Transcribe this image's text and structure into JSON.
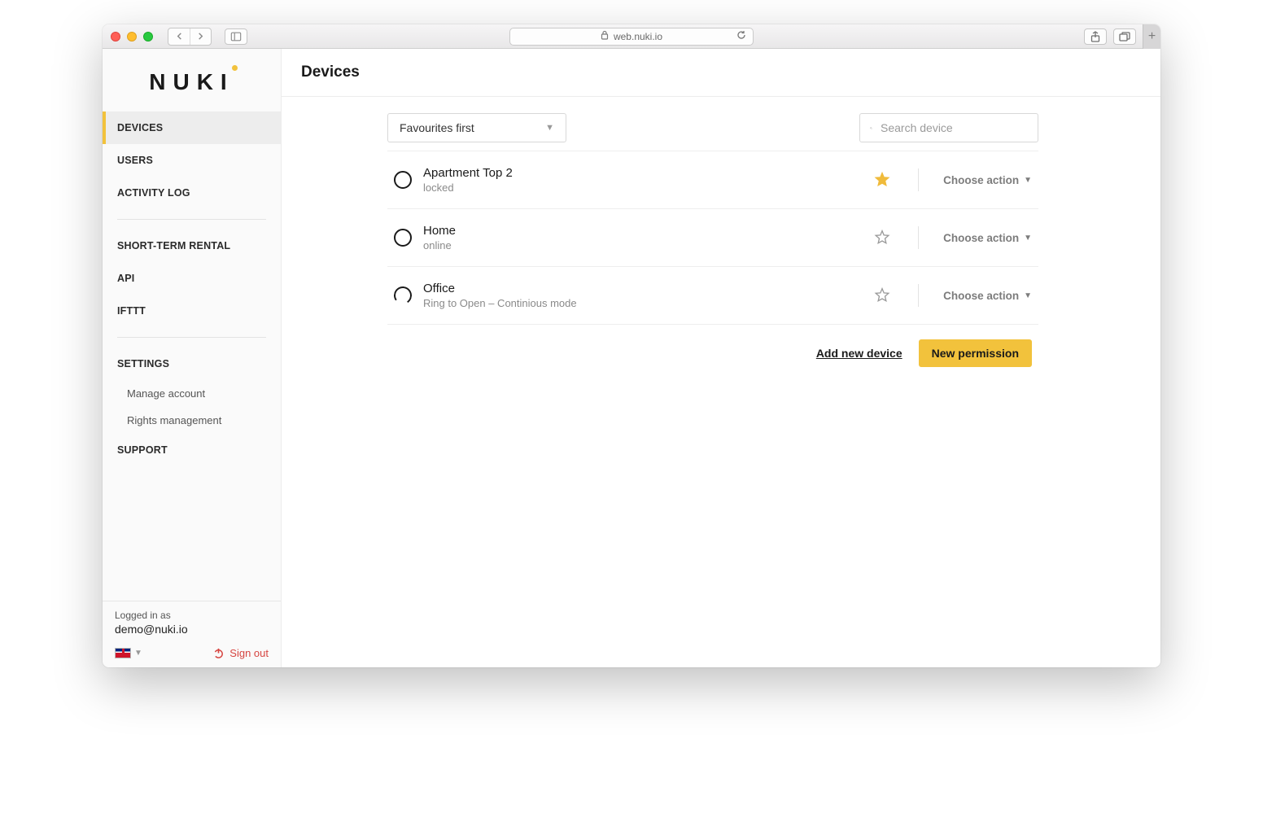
{
  "browser": {
    "url": "web.nuki.io"
  },
  "brand": {
    "logo_text": "NUKI"
  },
  "sidebar": {
    "items": [
      {
        "label": "DEVICES"
      },
      {
        "label": "USERS"
      },
      {
        "label": "ACTIVITY LOG"
      },
      {
        "label": "SHORT-TERM RENTAL"
      },
      {
        "label": "API"
      },
      {
        "label": "IFTTT"
      },
      {
        "label": "SETTINGS"
      },
      {
        "label": "SUPPORT"
      }
    ],
    "settings_sub": [
      {
        "label": "Manage account"
      },
      {
        "label": "Rights management"
      }
    ],
    "footer": {
      "logged_in_as": "Logged in as",
      "email": "demo@nuki.io",
      "signout": "Sign out"
    }
  },
  "page": {
    "title": "Devices",
    "sort_label": "Favourites first",
    "search_placeholder": "Search device",
    "choose_action": "Choose action",
    "add_device": "Add new device",
    "new_permission": "New permission"
  },
  "devices": [
    {
      "name": "Apartment Top 2",
      "status": "locked",
      "favourite": true,
      "ring": "closed"
    },
    {
      "name": "Home",
      "status": "online",
      "favourite": false,
      "ring": "closed"
    },
    {
      "name": "Office",
      "status": "Ring to Open – Continious mode",
      "favourite": false,
      "ring": "open"
    }
  ]
}
